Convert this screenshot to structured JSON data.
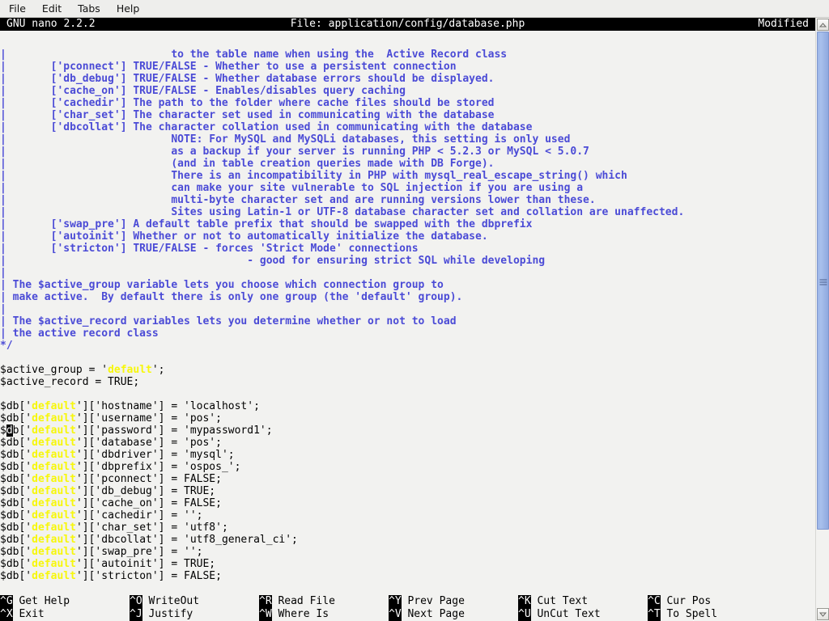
{
  "menubar": {
    "items": [
      {
        "label": "File",
        "name": "menu-file"
      },
      {
        "label": "Edit",
        "name": "menu-edit"
      },
      {
        "label": "Tabs",
        "name": "menu-tabs"
      },
      {
        "label": "Help",
        "name": "menu-help"
      }
    ]
  },
  "titlebar": {
    "version": "GNU nano 2.2.2",
    "file_label": "File: application/config/database.php",
    "modified": "Modified"
  },
  "editor": {
    "lines": [
      {
        "segments": [
          {
            "t": "|                          to the table name when using the  Active Record class",
            "c": "cmt"
          }
        ]
      },
      {
        "segments": [
          {
            "t": "|       ['pconnect'] TRUE/FALSE - Whether to use a persistent connection",
            "c": "cmt"
          }
        ]
      },
      {
        "segments": [
          {
            "t": "|       ['db_debug'] TRUE/FALSE - Whether database errors should be displayed.",
            "c": "cmt"
          }
        ]
      },
      {
        "segments": [
          {
            "t": "|       ['cache_on'] TRUE/FALSE - Enables/disables query caching",
            "c": "cmt"
          }
        ]
      },
      {
        "segments": [
          {
            "t": "|       ['cachedir'] The path to the folder where cache files should be stored",
            "c": "cmt"
          }
        ]
      },
      {
        "segments": [
          {
            "t": "|       ['char_set'] The character set used in communicating with the database",
            "c": "cmt"
          }
        ]
      },
      {
        "segments": [
          {
            "t": "|       ['dbcollat'] The character collation used in communicating with the database",
            "c": "cmt"
          }
        ]
      },
      {
        "segments": [
          {
            "t": "|                          NOTE: For MySQL and MySQLi databases, this setting is only used",
            "c": "cmt"
          }
        ]
      },
      {
        "segments": [
          {
            "t": "|                          as a backup if your server is running PHP < 5.2.3 or MySQL < 5.0.7",
            "c": "cmt"
          }
        ]
      },
      {
        "segments": [
          {
            "t": "|                          (and in table creation queries made with DB Forge).",
            "c": "cmt"
          }
        ]
      },
      {
        "segments": [
          {
            "t": "|                          There is an incompatibility in PHP with mysql_real_escape_string() which",
            "c": "cmt"
          }
        ]
      },
      {
        "segments": [
          {
            "t": "|                          can make your site vulnerable to SQL injection if you are using a",
            "c": "cmt"
          }
        ]
      },
      {
        "segments": [
          {
            "t": "|                          multi-byte character set and are running versions lower than these.",
            "c": "cmt"
          }
        ]
      },
      {
        "segments": [
          {
            "t": "|                          Sites using Latin-1 or UTF-8 database character set and collation are unaffected.",
            "c": "cmt"
          }
        ]
      },
      {
        "segments": [
          {
            "t": "|       ['swap_pre'] A default table prefix that should be swapped with the dbprefix",
            "c": "cmt"
          }
        ]
      },
      {
        "segments": [
          {
            "t": "|       ['autoinit'] Whether or not to automatically initialize the database.",
            "c": "cmt"
          }
        ]
      },
      {
        "segments": [
          {
            "t": "|       ['stricton'] TRUE/FALSE - forces 'Strict Mode' connections",
            "c": "cmt"
          }
        ]
      },
      {
        "segments": [
          {
            "t": "|                                      - good for ensuring strict SQL while developing",
            "c": "cmt"
          }
        ]
      },
      {
        "segments": [
          {
            "t": "|",
            "c": "cmt"
          }
        ]
      },
      {
        "segments": [
          {
            "t": "| The $active_group variable lets you choose which connection group to",
            "c": "cmt"
          }
        ]
      },
      {
        "segments": [
          {
            "t": "| make active.  By default there is only one group (the 'default' group).",
            "c": "cmt"
          }
        ]
      },
      {
        "segments": [
          {
            "t": "|",
            "c": "cmt"
          }
        ]
      },
      {
        "segments": [
          {
            "t": "| The $active_record variables lets you determine whether or not to load",
            "c": "cmt"
          }
        ]
      },
      {
        "segments": [
          {
            "t": "| the active record class",
            "c": "cmt"
          }
        ]
      },
      {
        "segments": [
          {
            "t": "*/",
            "c": "cmt"
          }
        ]
      },
      {
        "segments": [
          {
            "t": "",
            "c": ""
          }
        ]
      },
      {
        "segments": [
          {
            "t": "$active_group = '",
            "c": ""
          },
          {
            "t": "default",
            "c": "hl"
          },
          {
            "t": "';",
            "c": ""
          }
        ]
      },
      {
        "segments": [
          {
            "t": "$active_record = TRUE;",
            "c": ""
          }
        ]
      },
      {
        "segments": [
          {
            "t": "",
            "c": ""
          }
        ]
      },
      {
        "segments": [
          {
            "t": "$db['",
            "c": ""
          },
          {
            "t": "default",
            "c": "hl"
          },
          {
            "t": "']['hostname'] = 'localhost';",
            "c": ""
          }
        ]
      },
      {
        "segments": [
          {
            "t": "$db['",
            "c": ""
          },
          {
            "t": "default",
            "c": "hl"
          },
          {
            "t": "']['username'] = 'pos';",
            "c": ""
          }
        ]
      },
      {
        "segments": [
          {
            "t": "$",
            "c": ""
          },
          {
            "t": "d",
            "c": "cur"
          },
          {
            "t": "b['",
            "c": ""
          },
          {
            "t": "default",
            "c": "hl"
          },
          {
            "t": "']['password'] = 'mypassword1';",
            "c": ""
          }
        ]
      },
      {
        "segments": [
          {
            "t": "$db['",
            "c": ""
          },
          {
            "t": "default",
            "c": "hl"
          },
          {
            "t": "']['database'] = 'pos';",
            "c": ""
          }
        ]
      },
      {
        "segments": [
          {
            "t": "$db['",
            "c": ""
          },
          {
            "t": "default",
            "c": "hl"
          },
          {
            "t": "']['dbdriver'] = 'mysql';",
            "c": ""
          }
        ]
      },
      {
        "segments": [
          {
            "t": "$db['",
            "c": ""
          },
          {
            "t": "default",
            "c": "hl"
          },
          {
            "t": "']['dbprefix'] = 'ospos_';",
            "c": ""
          }
        ]
      },
      {
        "segments": [
          {
            "t": "$db['",
            "c": ""
          },
          {
            "t": "default",
            "c": "hl"
          },
          {
            "t": "']['pconnect'] = FALSE;",
            "c": ""
          }
        ]
      },
      {
        "segments": [
          {
            "t": "$db['",
            "c": ""
          },
          {
            "t": "default",
            "c": "hl"
          },
          {
            "t": "']['db_debug'] = TRUE;",
            "c": ""
          }
        ]
      },
      {
        "segments": [
          {
            "t": "$db['",
            "c": ""
          },
          {
            "t": "default",
            "c": "hl"
          },
          {
            "t": "']['cache_on'] = FALSE;",
            "c": ""
          }
        ]
      },
      {
        "segments": [
          {
            "t": "$db['",
            "c": ""
          },
          {
            "t": "default",
            "c": "hl"
          },
          {
            "t": "']['cachedir'] = '';",
            "c": ""
          }
        ]
      },
      {
        "segments": [
          {
            "t": "$db['",
            "c": ""
          },
          {
            "t": "default",
            "c": "hl"
          },
          {
            "t": "']['char_set'] = 'utf8';",
            "c": ""
          }
        ]
      },
      {
        "segments": [
          {
            "t": "$db['",
            "c": ""
          },
          {
            "t": "default",
            "c": "hl"
          },
          {
            "t": "']['dbcollat'] = 'utf8_general_ci';",
            "c": ""
          }
        ]
      },
      {
        "segments": [
          {
            "t": "$db['",
            "c": ""
          },
          {
            "t": "default",
            "c": "hl"
          },
          {
            "t": "']['swap_pre'] = '';",
            "c": ""
          }
        ]
      },
      {
        "segments": [
          {
            "t": "$db['",
            "c": ""
          },
          {
            "t": "default",
            "c": "hl"
          },
          {
            "t": "']['autoinit'] = TRUE;",
            "c": ""
          }
        ]
      },
      {
        "segments": [
          {
            "t": "$db['",
            "c": ""
          },
          {
            "t": "default",
            "c": "hl"
          },
          {
            "t": "']['stricton'] = FALSE;",
            "c": ""
          }
        ]
      }
    ]
  },
  "helpbar": {
    "rows": [
      [
        {
          "key": "^G",
          "label": "Get Help",
          "name": "shortcut-get-help"
        },
        {
          "key": "^O",
          "label": "WriteOut",
          "name": "shortcut-writeout"
        },
        {
          "key": "^R",
          "label": "Read File",
          "name": "shortcut-read-file"
        },
        {
          "key": "^Y",
          "label": "Prev Page",
          "name": "shortcut-prev-page"
        },
        {
          "key": "^K",
          "label": "Cut Text",
          "name": "shortcut-cut-text"
        },
        {
          "key": "^C",
          "label": "Cur Pos",
          "name": "shortcut-cur-pos"
        }
      ],
      [
        {
          "key": "^X",
          "label": "Exit",
          "name": "shortcut-exit"
        },
        {
          "key": "^J",
          "label": "Justify",
          "name": "shortcut-justify"
        },
        {
          "key": "^W",
          "label": "Where Is",
          "name": "shortcut-where-is"
        },
        {
          "key": "^V",
          "label": "Next Page",
          "name": "shortcut-next-page"
        },
        {
          "key": "^U",
          "label": "UnCut Text",
          "name": "shortcut-uncut-text"
        },
        {
          "key": "^T",
          "label": "To Spell",
          "name": "shortcut-to-spell"
        }
      ]
    ]
  },
  "scrollbar": {
    "up_arrow": "scroll-up-arrow",
    "down_arrow": "scroll-down-arrow"
  },
  "colors": {
    "background": "#f2f2f0",
    "comment": "#4b4bd6",
    "highlight": "#f7f70b",
    "titlebar_bg": "#000000",
    "titlebar_fg": "#ffffff",
    "scrollbar_thumb": "#9db7e9"
  }
}
